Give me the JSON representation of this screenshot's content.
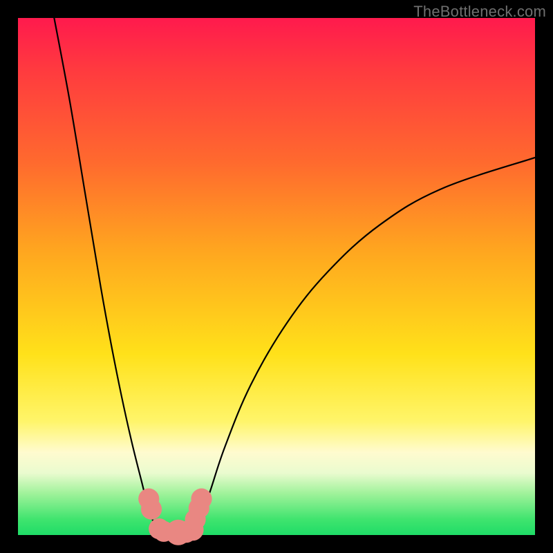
{
  "watermark": "TheBottleneck.com",
  "chart_data": {
    "type": "line",
    "title": "",
    "xlabel": "",
    "ylabel": "",
    "xlim": [
      0,
      100
    ],
    "ylim": [
      0,
      100
    ],
    "legend": false,
    "grid": false,
    "series": [
      {
        "name": "left-curve",
        "x": [
          7,
          10,
          13,
          16,
          18,
          20,
          22,
          24,
          25,
          26,
          27,
          28,
          29
        ],
        "y": [
          100,
          84,
          66,
          48,
          37,
          27,
          18,
          10,
          6,
          3,
          1.5,
          0.8,
          0.5
        ]
      },
      {
        "name": "right-curve",
        "x": [
          33,
          34,
          35,
          37,
          40,
          45,
          52,
          60,
          70,
          82,
          100
        ],
        "y": [
          0.5,
          1,
          3,
          8,
          17,
          29,
          41,
          51,
          60,
          67,
          73
        ]
      },
      {
        "name": "valley-floor",
        "x": [
          28,
          29,
          30,
          31,
          32,
          33
        ],
        "y": [
          0.8,
          0.5,
          0.4,
          0.4,
          0.4,
          0.5
        ]
      }
    ],
    "markers": [
      {
        "x": 25.3,
        "y": 7,
        "r": 1.5
      },
      {
        "x": 25.8,
        "y": 5,
        "r": 1.5
      },
      {
        "x": 27.3,
        "y": 1.2,
        "r": 1.5
      },
      {
        "x": 28.2,
        "y": 0.7,
        "r": 1.5
      },
      {
        "x": 31.0,
        "y": 0.5,
        "r": 2.0
      },
      {
        "x": 32.5,
        "y": 0.6,
        "r": 1.6
      },
      {
        "x": 33.8,
        "y": 1.0,
        "r": 1.6
      },
      {
        "x": 34.3,
        "y": 3.0,
        "r": 1.5
      },
      {
        "x": 35.0,
        "y": 5.2,
        "r": 1.5
      },
      {
        "x": 35.5,
        "y": 7.0,
        "r": 1.5
      }
    ],
    "colors": {
      "curve": "#000000",
      "marker": "#e98782",
      "gradient_top": "#ff1a4d",
      "gradient_mid": "#ffe11a",
      "gradient_bot": "#1fdc67"
    }
  }
}
